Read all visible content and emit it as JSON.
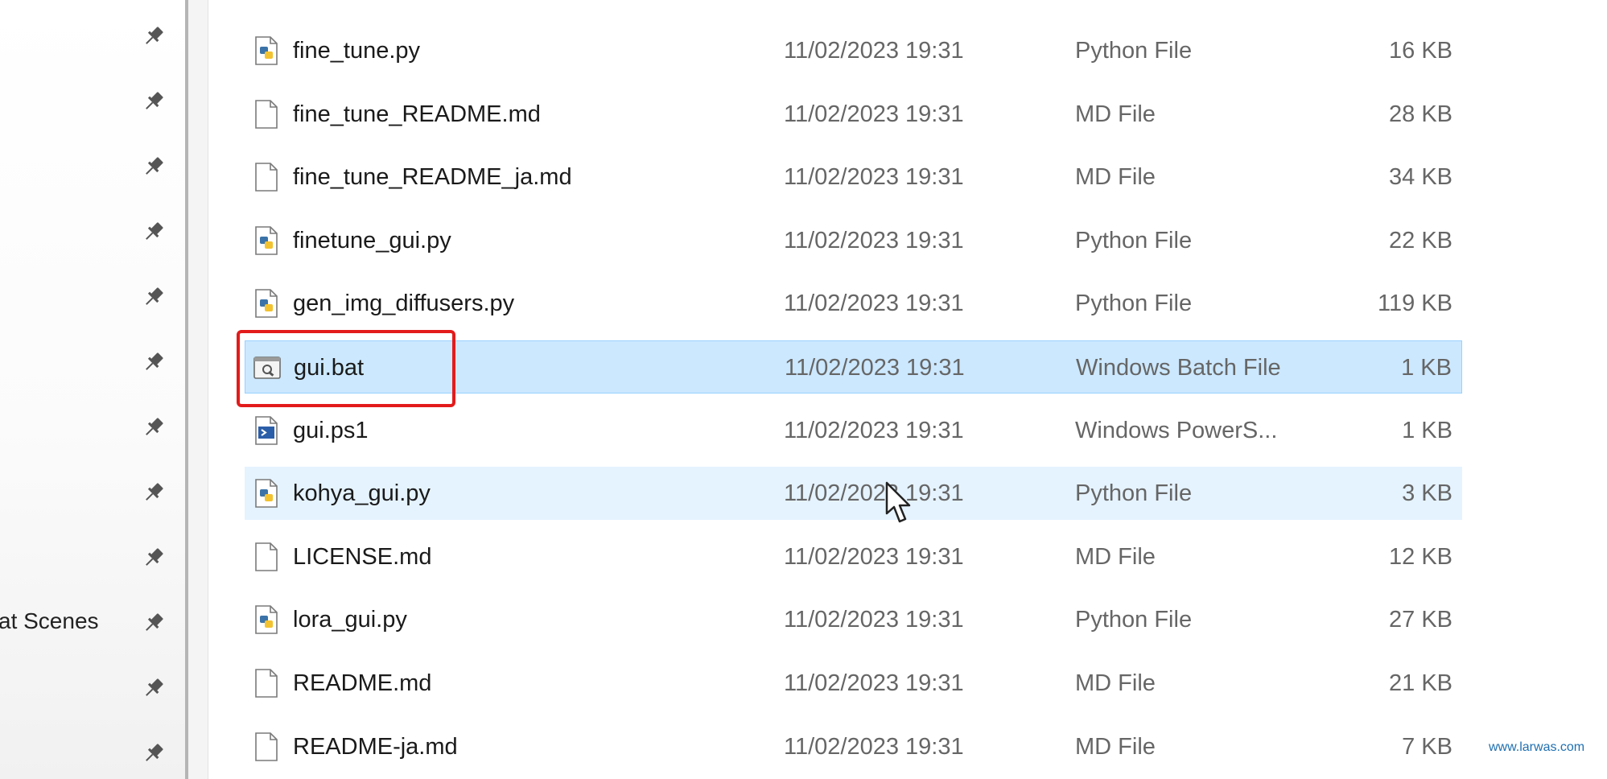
{
  "nav": {
    "items": [
      {
        "label": ""
      },
      {
        "label": ""
      },
      {
        "label": ""
      },
      {
        "label": ""
      },
      {
        "label": ""
      },
      {
        "label": ""
      },
      {
        "label": ""
      },
      {
        "label": ""
      },
      {
        "label": ""
      },
      {
        "label": "at Scenes"
      },
      {
        "label": ""
      },
      {
        "label": ""
      }
    ]
  },
  "files": [
    {
      "name": "fine_tune.py",
      "date": "11/02/2023 19:31",
      "type": "Python File",
      "size": "16 KB",
      "icon": "python-file-icon"
    },
    {
      "name": "fine_tune_README.md",
      "date": "11/02/2023 19:31",
      "type": "MD File",
      "size": "28 KB",
      "icon": "md-file-icon"
    },
    {
      "name": "fine_tune_README_ja.md",
      "date": "11/02/2023 19:31",
      "type": "MD File",
      "size": "34 KB",
      "icon": "md-file-icon"
    },
    {
      "name": "finetune_gui.py",
      "date": "11/02/2023 19:31",
      "type": "Python File",
      "size": "22 KB",
      "icon": "python-file-icon"
    },
    {
      "name": "gen_img_diffusers.py",
      "date": "11/02/2023 19:31",
      "type": "Python File",
      "size": "119 KB",
      "icon": "python-file-icon"
    },
    {
      "name": "gui.bat",
      "date": "11/02/2023 19:31",
      "type": "Windows Batch File",
      "size": "1 KB",
      "icon": "batch-file-icon",
      "state": "selected"
    },
    {
      "name": "gui.ps1",
      "date": "11/02/2023 19:31",
      "type": "Windows PowerS...",
      "size": "1 KB",
      "icon": "powershell-file-icon"
    },
    {
      "name": "kohya_gui.py",
      "date": "11/02/2023 19:31",
      "type": "Python File",
      "size": "3 KB",
      "icon": "python-file-icon",
      "state": "hover"
    },
    {
      "name": "LICENSE.md",
      "date": "11/02/2023 19:31",
      "type": "MD File",
      "size": "12 KB",
      "icon": "md-file-icon"
    },
    {
      "name": "lora_gui.py",
      "date": "11/02/2023 19:31",
      "type": "Python File",
      "size": "27 KB",
      "icon": "python-file-icon"
    },
    {
      "name": "README.md",
      "date": "11/02/2023 19:31",
      "type": "MD File",
      "size": "21 KB",
      "icon": "md-file-icon"
    },
    {
      "name": "README-ja.md",
      "date": "11/02/2023 19:31",
      "type": "MD File",
      "size": "7 KB",
      "icon": "md-file-icon"
    }
  ],
  "colors": {
    "selected_bg": "#cce8ff",
    "hover_bg": "#e5f3ff",
    "highlight_border": "#e31b1b"
  },
  "watermark": "www.larwas.com"
}
